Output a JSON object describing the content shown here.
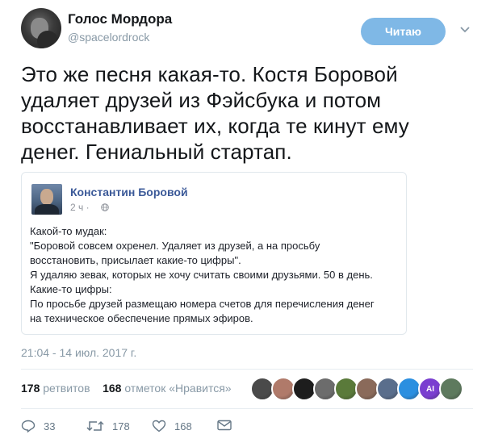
{
  "tweet": {
    "author_name": "Голос Мордора",
    "author_handle": "@spacelordrock",
    "follow_label": "Читаю",
    "text": "Это же песня какая-то. Костя Боровой удаляет друзей из Фэйсбука и потом восстанавливает их, когда те кинут ему денег. Гениальный стартап.",
    "timestamp": "21:04 - 14 июл. 2017 г."
  },
  "quoted_post": {
    "author_name": "Константин Боровой",
    "time": "2 ч ·",
    "lines": [
      "Какой-то мудак:",
      "\"Боровой совсем охренел. Удаляет из друзей, а на просьбу",
      "восстановить, присылает какие-то цифры\".",
      "Я удаляю зевак, которых не хочу считать своими друзьями. 50 в день.",
      "Какие-то цифры:",
      "По просьбе друзей размещаю номера счетов для перечисления денег",
      "на техническое обеспечение прямых эфиров."
    ]
  },
  "stats": {
    "retweets_count": "178",
    "retweets_label": "ретвитов",
    "likes_count": "168",
    "likes_label": "отметок «Нравится»"
  },
  "likers": [
    {
      "icon": "liker-avatar",
      "color": "#4a4a4a",
      "text": ""
    },
    {
      "icon": "liker-avatar",
      "color": "#b07a6a",
      "text": ""
    },
    {
      "icon": "liker-avatar",
      "color": "#1d1d1d",
      "text": ""
    },
    {
      "icon": "liker-avatar",
      "color": "#6c6c6c",
      "text": ""
    },
    {
      "icon": "liker-avatar",
      "color": "#5a7a3a",
      "text": ""
    },
    {
      "icon": "liker-avatar",
      "color": "#8a6a5a",
      "text": ""
    },
    {
      "icon": "liker-avatar",
      "color": "#5a6e8c",
      "text": ""
    },
    {
      "icon": "liker-avatar",
      "color": "#2b8fe0",
      "text": ""
    },
    {
      "icon": "liker-avatar",
      "color": "#7a3fd0",
      "text": "AI"
    },
    {
      "icon": "liker-avatar",
      "color": "#5e7a5e",
      "text": ""
    }
  ],
  "actions": {
    "replies": "33",
    "retweets": "178",
    "likes": "168"
  },
  "colors": {
    "follow_button": "#7fb8e6",
    "fb_name": "#3b5998",
    "muted": "#8899a6"
  }
}
